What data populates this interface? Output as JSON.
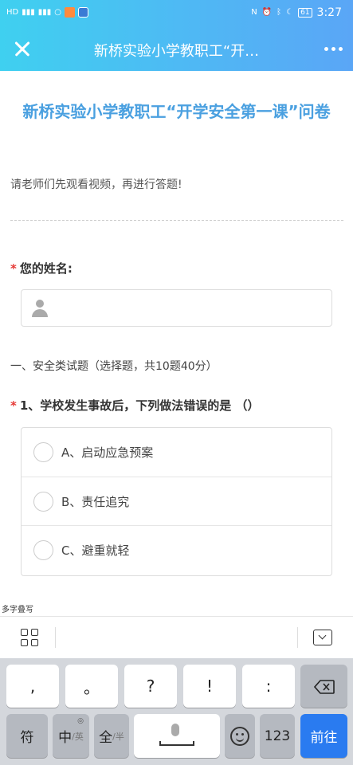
{
  "status_bar": {
    "left_icons": [
      "hd-icon",
      "signal-icon",
      "signal-icon",
      "circle-icon",
      "app-orange-icon",
      "app-blue-icon"
    ],
    "right_icons": [
      "nfc-icon",
      "alarm-icon",
      "bluetooth-icon",
      "moon-icon"
    ],
    "battery": "61",
    "time": "3:27"
  },
  "header": {
    "title": "新桥实验小学教职工“开…"
  },
  "survey": {
    "title": "新桥实验小学教职工“开学安全第一课”问卷",
    "intro": "请老师们先观看视频，再进行答题!",
    "name_question": "您的姓名:",
    "required_mark": "*",
    "section_heading": "一、安全类试题（选择题，共10题40分）",
    "question1": "1、学校发生事故后，下列做法错误的是 （）",
    "options": [
      {
        "label": "A、启动应急预案"
      },
      {
        "label": "B、责任追究"
      },
      {
        "label": "C、避重就轻"
      }
    ]
  },
  "keyboard": {
    "mode_label": "多字叠写",
    "row1": [
      ",",
      "。",
      "?",
      "!",
      ":"
    ],
    "fu": "符",
    "zh_main": "中",
    "zh_sub": "/英",
    "quan_main": "全",
    "quan_sub": "/半",
    "num": "123",
    "go": "前往",
    "globe": "◎"
  }
}
